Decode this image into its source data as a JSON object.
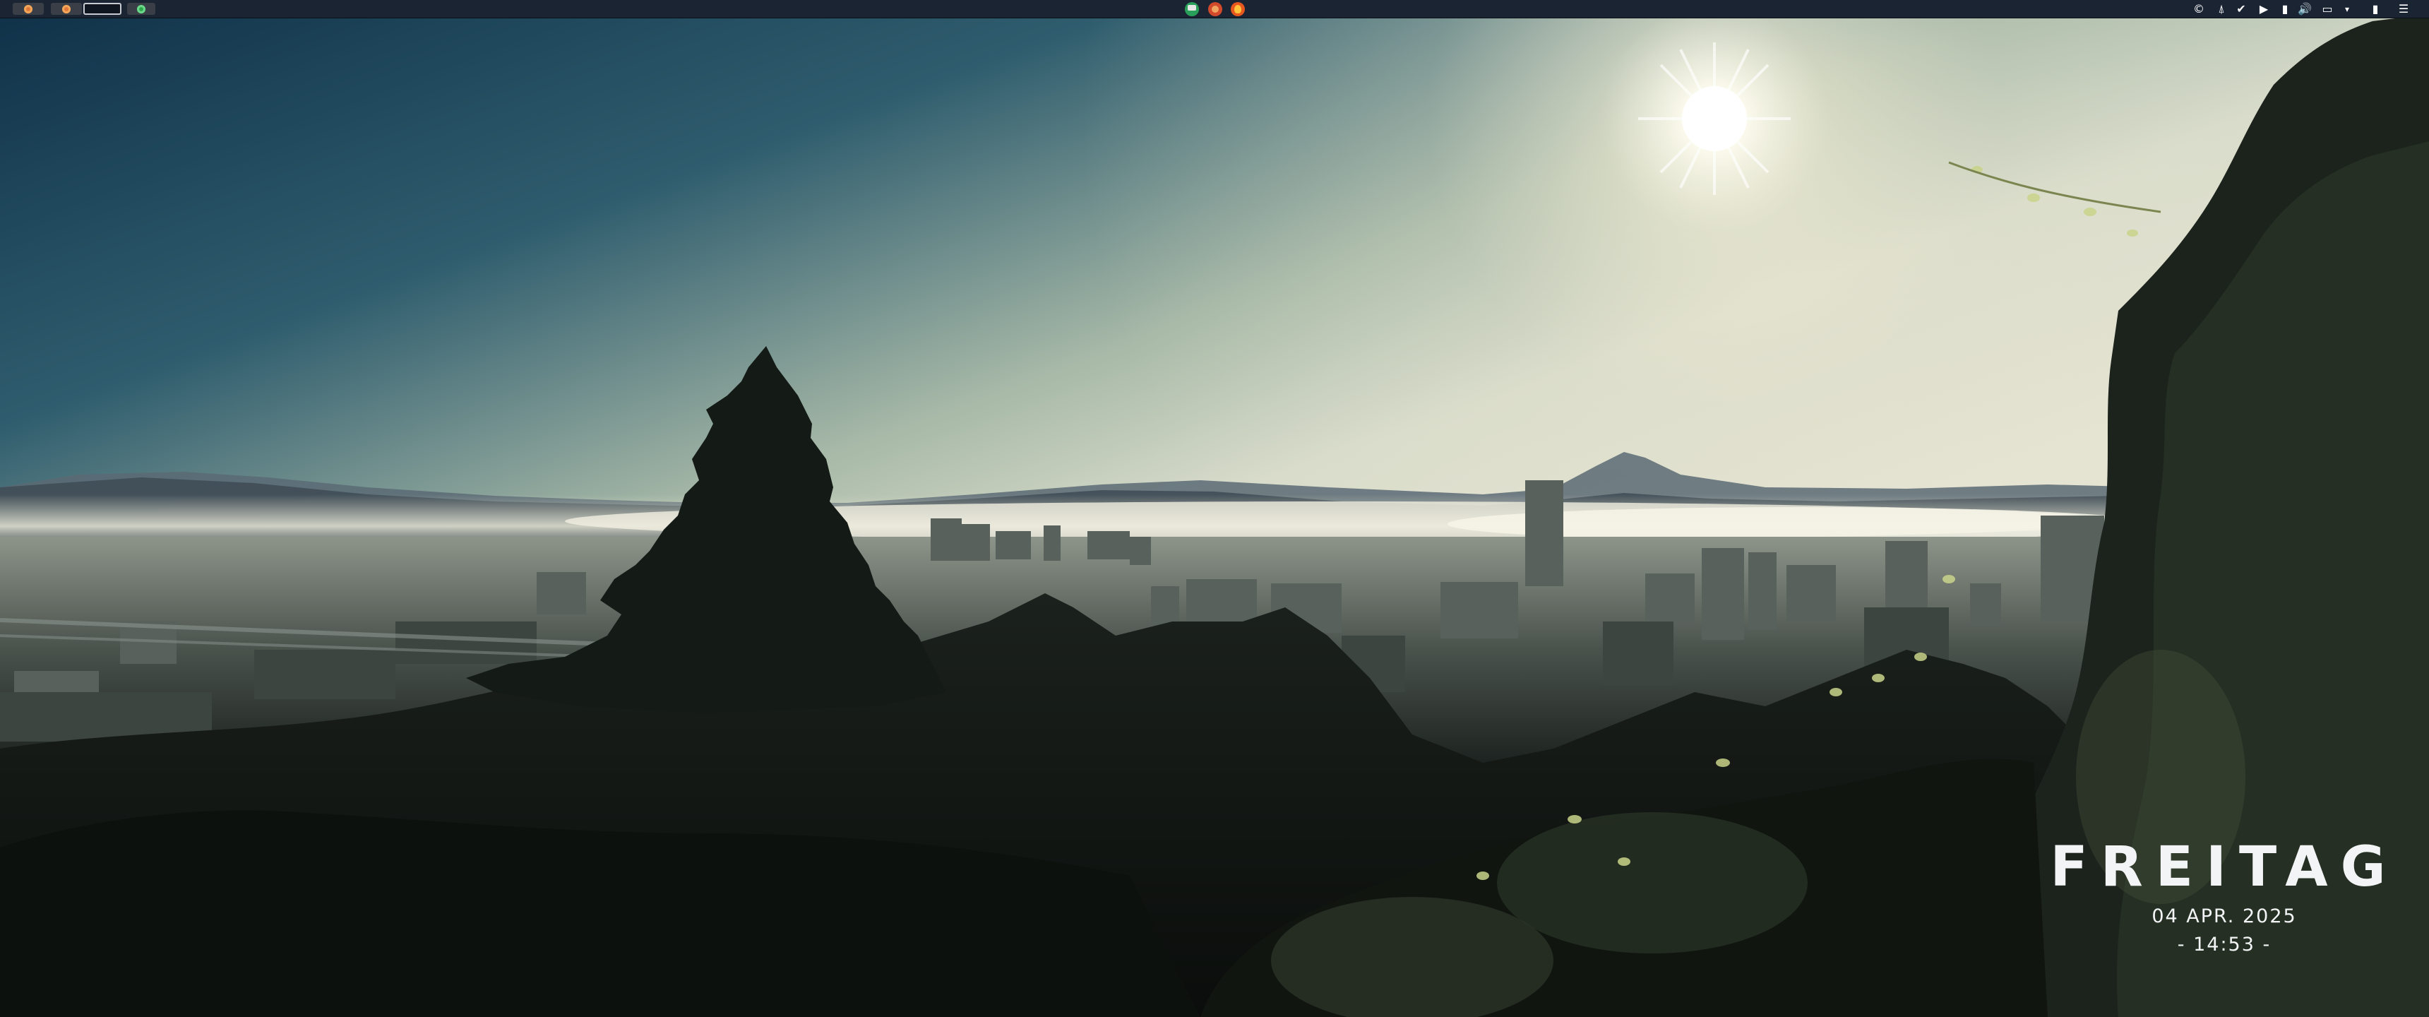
{
  "screen": {
    "description": "",
    "wallpaper_name": "city-skyline-sunrise"
  },
  "top_panel": {
    "workspaces": [
      {
        "name": "workspace-1",
        "icon": "orange-dot-icon",
        "active": false
      },
      {
        "name": "workspace-2",
        "icon": "orange-dot-icon",
        "active": false
      },
      {
        "name": "workspace-3",
        "icon": "",
        "active": true
      },
      {
        "name": "workspace-4",
        "icon": "green-dot-icon",
        "active": false
      }
    ],
    "apps": [
      {
        "name": "terminal-app-icon"
      },
      {
        "name": "app-launcher-icon"
      },
      {
        "name": "firefox-icon"
      }
    ],
    "tray": [
      {
        "name": "copyright-app-icon",
        "glyph": "©"
      },
      {
        "name": "arch-icon",
        "glyph": "⍋"
      },
      {
        "name": "checkmark-icon",
        "glyph": "✔"
      },
      {
        "name": "play-icon",
        "glyph": "▶"
      },
      {
        "name": "clipboard-icon",
        "glyph": "▮"
      },
      {
        "name": "volume-icon",
        "glyph": "🔊"
      },
      {
        "name": "display-icon",
        "glyph": "▭"
      },
      {
        "name": "dropdown-icon",
        "glyph": "▾"
      },
      {
        "name": "battery-icon",
        "glyph": "▮"
      },
      {
        "name": "menu-icon",
        "glyph": "☰"
      }
    ]
  },
  "date_widget": {
    "day_name": "FREITAG",
    "date": "04 APR. 2025",
    "time": "- 14:53 -"
  },
  "colors": {
    "panel_bg": "#1b2433",
    "accent_orange": "#e2773c",
    "accent_green": "#2fa84f",
    "widget_text": "#f3f4f5"
  }
}
